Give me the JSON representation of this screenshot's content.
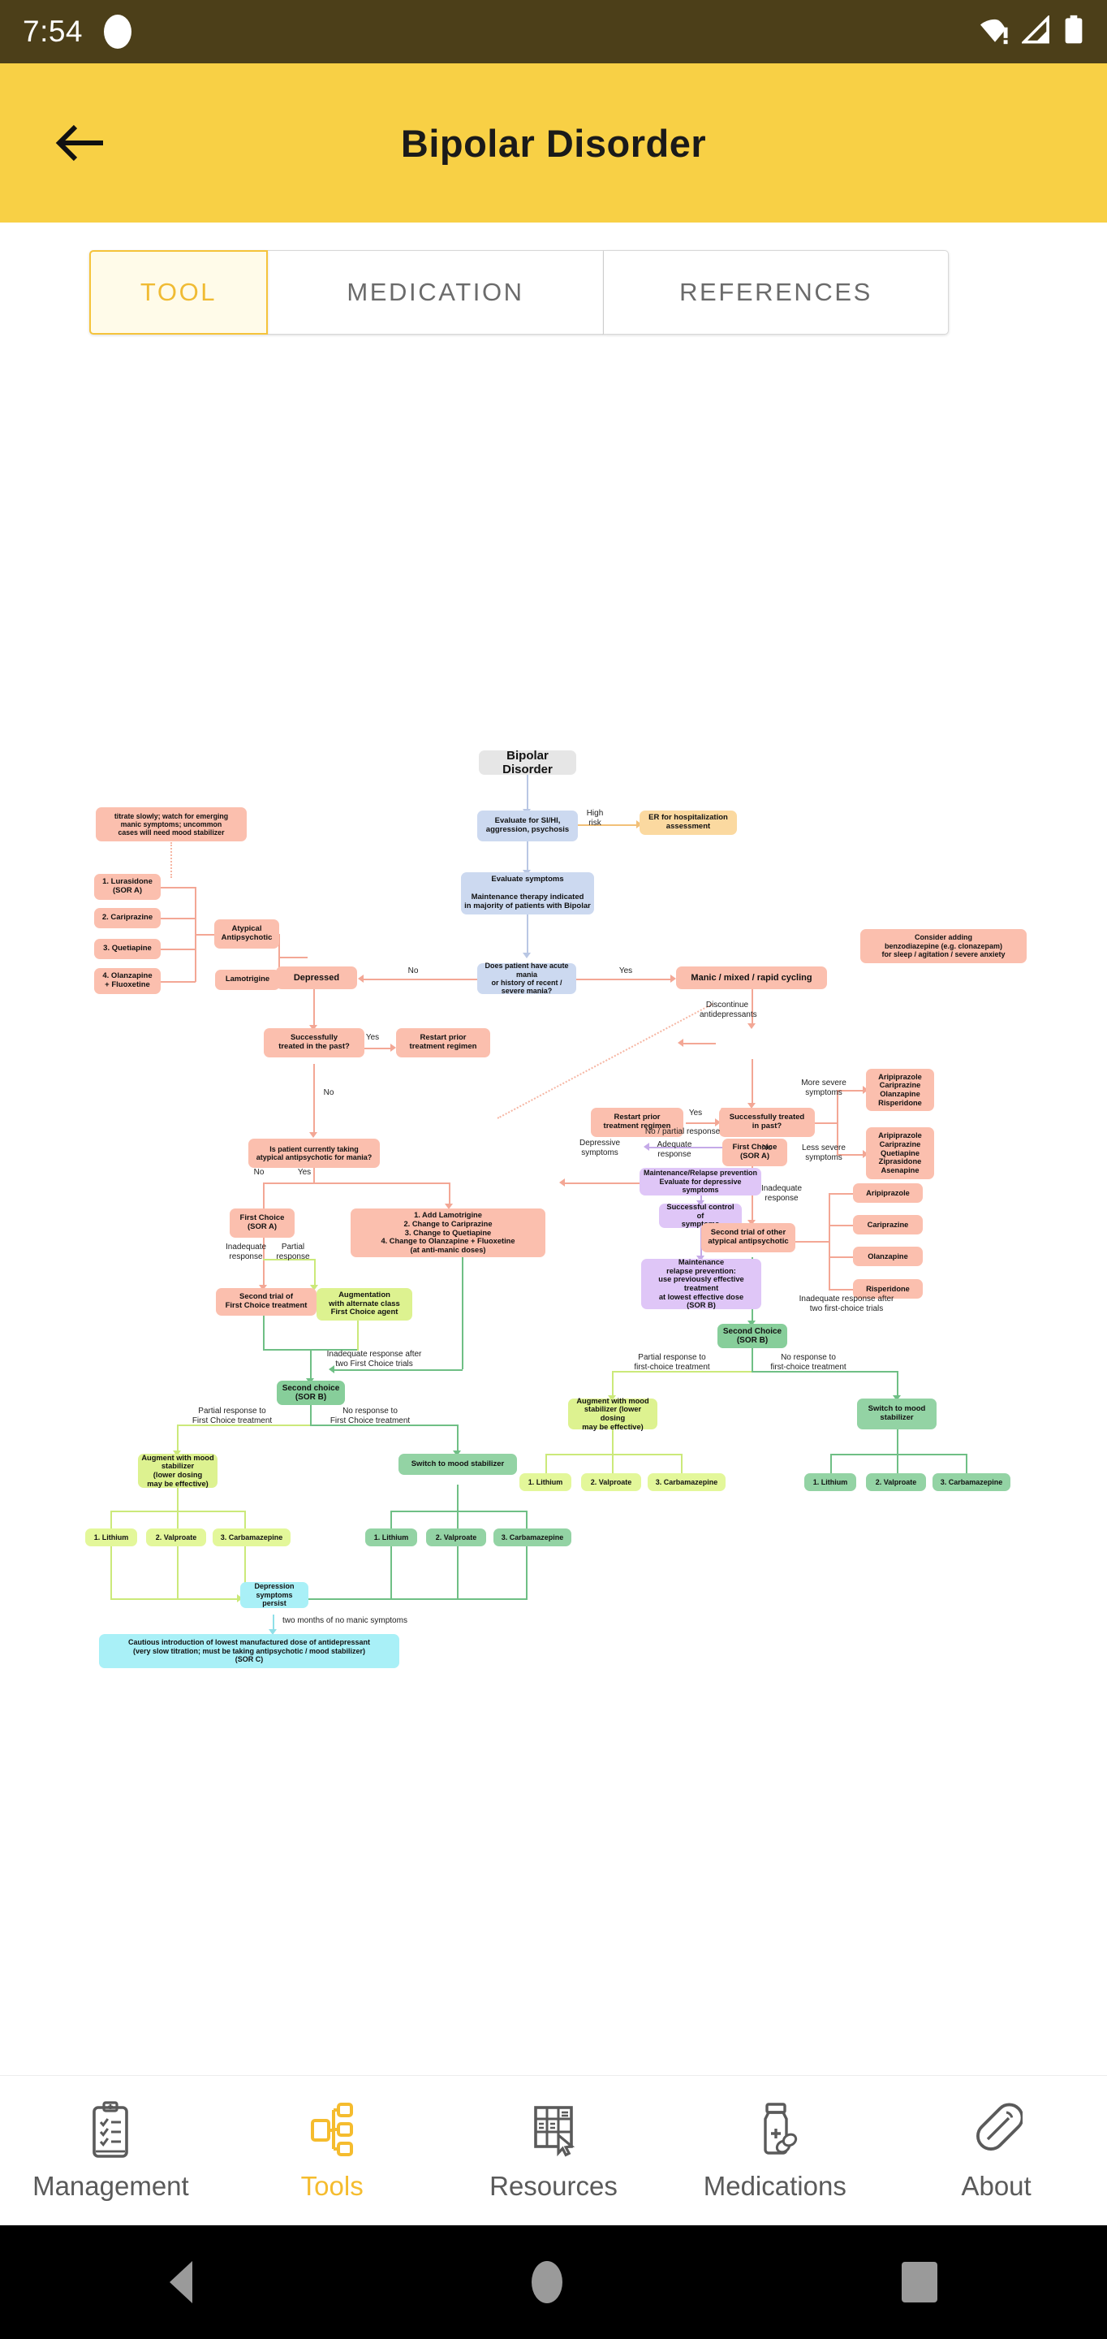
{
  "statusbar": {
    "time": "7:54",
    "icons": [
      "notification-dot",
      "wifi-warning-icon",
      "cell-signal-icon",
      "battery-icon"
    ]
  },
  "appbar": {
    "title": "Bipolar Disorder",
    "back_icon": "back-arrow-icon"
  },
  "tabs": [
    {
      "label": "TOOL",
      "active": true
    },
    {
      "label": "MEDICATION",
      "active": false
    },
    {
      "label": "REFERENCES",
      "active": false
    }
  ],
  "bottom_nav": [
    {
      "label": "Management",
      "icon": "clipboard-checklist-icon",
      "active": false
    },
    {
      "label": "Tools",
      "icon": "flowchart-tree-icon",
      "active": true
    },
    {
      "label": "Resources",
      "icon": "bookshelf-cursor-icon",
      "active": false
    },
    {
      "label": "Medications",
      "icon": "pill-bottle-icon",
      "active": false
    },
    {
      "label": "About",
      "icon": "capsule-pill-icon",
      "active": false
    }
  ],
  "system_nav": [
    {
      "label": "back",
      "icon": "triangle-back-icon"
    },
    {
      "label": "home",
      "icon": "circle-home-icon"
    },
    {
      "label": "recents",
      "icon": "square-recents-icon"
    }
  ],
  "chart_data": {
    "type": "diagram",
    "title": "Bipolar Disorder",
    "subtype": "clinical-treatment-flowchart",
    "colors": {
      "root": "#e6e6e6",
      "assessment": "#ccd9f0",
      "urgent": "#fbd9a0",
      "acute": "#fbbfae",
      "maintenance": "#dfc6f7",
      "augment": "#ddf290",
      "second_choice": "#87ce9a",
      "persist": "#a9f0f7"
    },
    "nodes": [
      {
        "id": "root",
        "text": "Bipolar Disorder",
        "color": "root"
      },
      {
        "id": "eval_si",
        "text": "Evaluate for SI/HI,\naggression, psychosis",
        "color": "assessment"
      },
      {
        "id": "er",
        "text": "ER for hospitalization\nassessment",
        "color": "urgent"
      },
      {
        "id": "eval_sx",
        "text": "Evaluate symptoms\n\nMaintenance therapy indicated\nin majority of patients with Bipolar",
        "color": "assessment"
      },
      {
        "id": "acute_mania_q",
        "text": "Does patient have acute mania\nor history of recent / severe mania?",
        "color": "assessment"
      },
      {
        "id": "depressed",
        "text": "Depressed",
        "color": "acute"
      },
      {
        "id": "manic",
        "text": "Manic / mixed / rapid cycling",
        "color": "acute"
      },
      {
        "id": "benzo",
        "text": "Consider adding\nbenzodiazepine (e.g. clonazepam)\nfor sleep / agitation / severe anxiety",
        "color": "acute"
      },
      {
        "id": "dep_success_q",
        "text": "Successfully\ntreated in the past?",
        "color": "acute"
      },
      {
        "id": "dep_restart",
        "text": "Restart prior\ntreatment regimen",
        "color": "acute"
      },
      {
        "id": "man_success_q",
        "text": "Successfully treated\nin past?",
        "color": "acute"
      },
      {
        "id": "man_restart",
        "text": "Restart prior\ntreatment regimen",
        "color": "acute"
      },
      {
        "id": "titrate_note",
        "text": "titrate slowly; watch for emerging\nmanic symptoms; uncommon\ncases will need mood stabilizer",
        "color": "acute"
      },
      {
        "id": "dep_1",
        "text": "1. Lurasidone\n(SOR A)",
        "color": "acute"
      },
      {
        "id": "dep_2",
        "text": "2. Cariprazine",
        "color": "acute"
      },
      {
        "id": "dep_3",
        "text": "3. Quetiapine",
        "color": "acute"
      },
      {
        "id": "dep_4",
        "text": "4. Olanzapine\n+ Fluoxetine",
        "color": "acute"
      },
      {
        "id": "atyp_anti",
        "text": "Atypical\nAntipsychotic",
        "color": "acute"
      },
      {
        "id": "lamotrigine",
        "text": "Lamotrigine",
        "color": "acute"
      },
      {
        "id": "taking_q",
        "text": "Is patient currently taking\natypical antipsychotic for mania?",
        "color": "acute"
      },
      {
        "id": "dep_first_choice",
        "text": "First Choice\n(SOR A)",
        "color": "acute"
      },
      {
        "id": "add_lam",
        "text": "1. Add Lamotrigine\n2. Change to Cariprazine\n3. Change to Quetiapine\n4. Change to Olanzapine + Fluoxetine\n(at anti-manic doses)",
        "color": "acute"
      },
      {
        "id": "dep_second_trial",
        "text": "Second trial of\nFirst Choice treatment",
        "color": "acute"
      },
      {
        "id": "augmentation",
        "text": "Augmentation\nwith alternate class\nFirst Choice agent",
        "color": "augment"
      },
      {
        "id": "dep_second_choice",
        "text": "Second choice\n(SOR B)",
        "color": "second_choice"
      },
      {
        "id": "dep_augment_ms",
        "text": "Augment with mood\nstabilizer\n(lower dosing\nmay be effective)",
        "color": "augment"
      },
      {
        "id": "dep_switch_ms",
        "text": "Switch to mood stabilizer",
        "color": "second_choice"
      },
      {
        "id": "dep_aug_li",
        "text": "1. Lithium",
        "color": "augment"
      },
      {
        "id": "dep_aug_val",
        "text": "2. Valproate",
        "color": "augment"
      },
      {
        "id": "dep_aug_carb",
        "text": "3. Carbamazepine",
        "color": "augment"
      },
      {
        "id": "dep_sw_li",
        "text": "1. Lithium",
        "color": "second_choice"
      },
      {
        "id": "dep_sw_val",
        "text": "2. Valproate",
        "color": "second_choice"
      },
      {
        "id": "dep_sw_carb",
        "text": "3. Carbamazepine",
        "color": "second_choice"
      },
      {
        "id": "dep_persist",
        "text": "Depression\nsymptoms persist",
        "color": "persist"
      },
      {
        "id": "cautious",
        "text": "Cautious introduction of lowest manufactured dose of antidepressant\n(very slow titration; must be taking antipsychotic / mood stabilizer)\n(SOR C)",
        "color": "persist"
      },
      {
        "id": "maint_relapse",
        "text": "Maintenance/Relapse prevention\nEvaluate for depressive symptoms",
        "color": "maintenance"
      },
      {
        "id": "succ_control",
        "text": "Successful control of\nsymptoms",
        "color": "maintenance"
      },
      {
        "id": "maint_prev",
        "text": "Maintenance\nrelapse prevention:\nuse previously effective treatment\nat lowest effective dose\n(SOR B)",
        "color": "maintenance"
      },
      {
        "id": "man_first_choice",
        "text": "First Choice\n(SOR A)",
        "color": "acute"
      },
      {
        "id": "more_severe_list",
        "text": "Aripiprazole\nCariprazine\nOlanzapine\nRisperidone",
        "color": "acute"
      },
      {
        "id": "less_severe_list",
        "text": "Aripiprazole\nCariprazine\nQuetiapine\nZiprasidone\nAsenapine",
        "color": "acute"
      },
      {
        "id": "man_second_trial",
        "text": "Second trial of other\natypical antipsychotic",
        "color": "acute"
      },
      {
        "id": "sec_arip",
        "text": "Aripiprazole",
        "color": "acute"
      },
      {
        "id": "sec_cari",
        "text": "Cariprazine",
        "color": "acute"
      },
      {
        "id": "sec_olan",
        "text": "Olanzapine",
        "color": "acute"
      },
      {
        "id": "sec_risp",
        "text": "Risperidone",
        "color": "acute"
      },
      {
        "id": "man_second_choice",
        "text": "Second Choice\n(SOR B)",
        "color": "second_choice"
      },
      {
        "id": "man_augment_ms",
        "text": "Augment with mood\nstabilizer (lower dosing\nmay be effective)",
        "color": "augment"
      },
      {
        "id": "man_switch_ms",
        "text": "Switch to mood\nstabilizer",
        "color": "second_choice"
      },
      {
        "id": "man_aug_li",
        "text": "1. Lithium",
        "color": "augment"
      },
      {
        "id": "man_aug_val",
        "text": "2. Valproate",
        "color": "augment"
      },
      {
        "id": "man_aug_carb",
        "text": "3. Carbamazepine",
        "color": "augment"
      },
      {
        "id": "man_sw_li",
        "text": "1. Lithium",
        "color": "second_choice"
      },
      {
        "id": "man_sw_val",
        "text": "2. Valproate",
        "color": "second_choice"
      },
      {
        "id": "man_sw_carb",
        "text": "3. Carbamazepine",
        "color": "second_choice"
      }
    ],
    "edge_labels": [
      "High\nrisk",
      "No",
      "Yes",
      "Yes",
      "No",
      "Yes",
      "No",
      "Discontinue\nantidepressants",
      "No / partial response",
      "Adequate\nresponse",
      "More severe\nsymptoms",
      "Less severe\nsymptoms",
      "Inadequate\nresponse",
      "Depressive\nsymptoms",
      "No",
      "Yes",
      "Inadequate\nresponse",
      "Partial\nresponse",
      "Inadequate response after\ntwo First Choice trials",
      "Inadequate response after\ntwo first-choice trials",
      "Partial response to\nFirst Choice treatment",
      "No response to\nFirst Choice treatment",
      "Partial response to\nfirst-choice treatment",
      "No response to\nfirst-choice treatment",
      "two months of no manic symptoms"
    ]
  }
}
